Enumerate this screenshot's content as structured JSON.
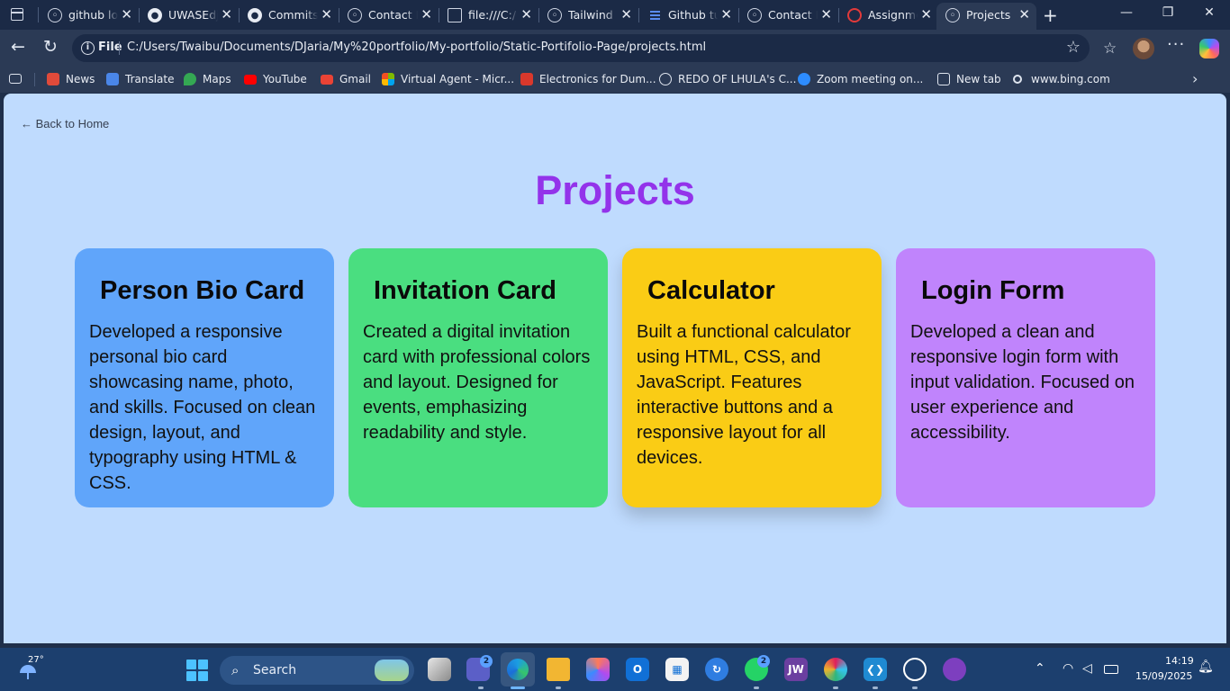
{
  "browser": {
    "tabs": [
      {
        "label": "github lo",
        "icon": "globe-icon"
      },
      {
        "label": "UWASEdj",
        "icon": "github-icon"
      },
      {
        "label": "Commits",
        "icon": "github-icon"
      },
      {
        "label": "Contact F",
        "icon": "globe-icon"
      },
      {
        "label": "file:///C:/",
        "icon": "file-icon"
      },
      {
        "label": "Tailwind F",
        "icon": "globe-icon"
      },
      {
        "label": "Github tu",
        "icon": "doc-icon"
      },
      {
        "label": "Contact F",
        "icon": "globe-icon"
      },
      {
        "label": "Assignme",
        "icon": "loading-icon"
      },
      {
        "label": "Projects",
        "icon": "globe-icon",
        "active": true
      }
    ],
    "address": {
      "scheme": "File",
      "url": "C:/Users/Twaibu/Documents/DJaria/My%20portfolio/My-portfolio/Static-Portifolio-Page/projects.html"
    },
    "favorites": [
      {
        "label": "News",
        "icon": "news-icon",
        "color": "#e04a3a"
      },
      {
        "label": "Translate",
        "icon": "translate-icon",
        "color": "#4a86e8"
      },
      {
        "label": "Maps",
        "icon": "maps-icon",
        "color": "#34a853"
      },
      {
        "label": "YouTube",
        "icon": "youtube-icon",
        "color": "#ff0000"
      },
      {
        "label": "Gmail",
        "icon": "gmail-icon",
        "color": "#ea4335"
      },
      {
        "label": "Virtual Agent - Micr...",
        "icon": "microsoft-icon",
        "color": "#f25022"
      },
      {
        "label": "Electronics for Dum...",
        "icon": "pdf-icon",
        "color": "#d9382c"
      },
      {
        "label": "REDO OF LHULA's C...",
        "icon": "globe-icon",
        "color": "#dfe5ef"
      },
      {
        "label": "Zoom meeting on...",
        "icon": "zoom-icon",
        "color": "#2d8cff"
      },
      {
        "label": "New tab",
        "icon": "newtab-icon",
        "color": "#dfe5ef"
      },
      {
        "label": "www.bing.com",
        "icon": "search-icon",
        "color": "#dfe5ef"
      }
    ]
  },
  "page": {
    "back_link": "← Back to Home",
    "title": "Projects",
    "colors": {
      "background": "#bfdbfe",
      "title": "#9333ea"
    },
    "cards": [
      {
        "title": "Person Bio Card",
        "description": "Developed a responsive personal bio card showcasing name, photo, and skills. Focused on clean design, layout, and typography using HTML & CSS.",
        "color": "#60a5fa"
      },
      {
        "title": "Invitation Card",
        "description": "Created a digital invitation card with professional colors and layout. Designed for events, emphasizing readability and style.",
        "color": "#4ade80"
      },
      {
        "title": "Calculator",
        "description": "Built a functional calculator using HTML, CSS, and JavaScript. Features interactive buttons and a responsive layout for all devices.",
        "color": "#facc15"
      },
      {
        "title": "Login Form",
        "description": "Developed a clean and responsive login form with input validation. Focused on user experience and accessibility.",
        "color": "#c084fc"
      }
    ]
  },
  "taskbar": {
    "temperature": "27°",
    "search_label": "Search",
    "teams_badge": "2",
    "whatsapp_badge": "2",
    "jw_label": "JW",
    "time": "14:19",
    "date": "15/09/2025"
  }
}
